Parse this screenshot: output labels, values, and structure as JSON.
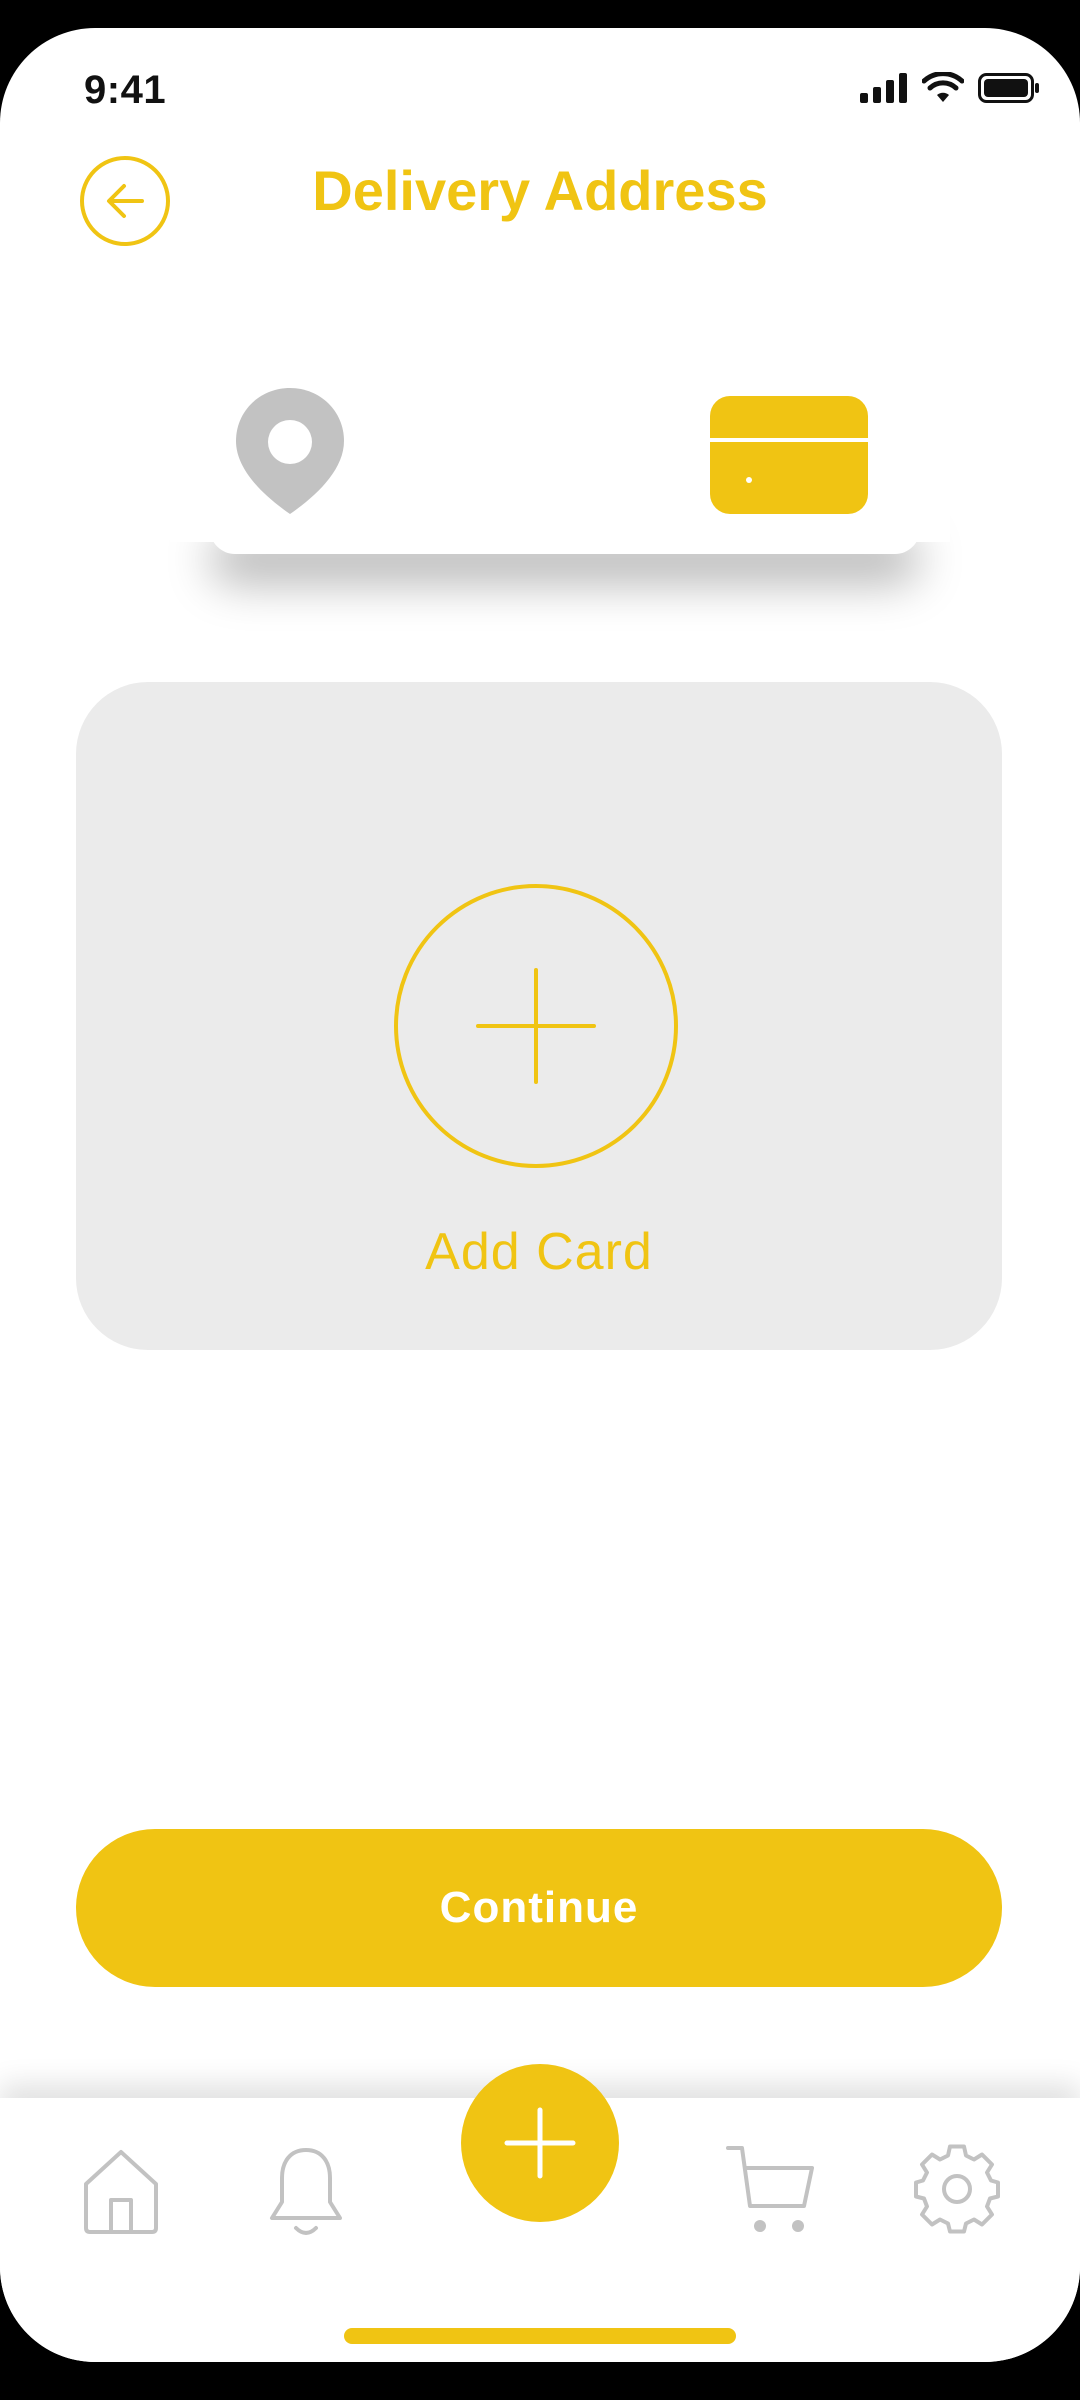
{
  "status_bar": {
    "time": "9:41"
  },
  "header": {
    "title": "Delivery Address"
  },
  "steps": {
    "icons": [
      "location-pin-icon",
      "credit-card-icon"
    ]
  },
  "add_card": {
    "label": "Add Card"
  },
  "continue": {
    "label": "Continue"
  },
  "tabbar": {
    "icons": [
      "home-icon",
      "bell-icon",
      "plus-icon",
      "cart-icon",
      "gear-icon"
    ]
  },
  "colors": {
    "accent": "#F0C413",
    "inactive": "#C2C2C2",
    "panel": "#EBEBEB"
  }
}
